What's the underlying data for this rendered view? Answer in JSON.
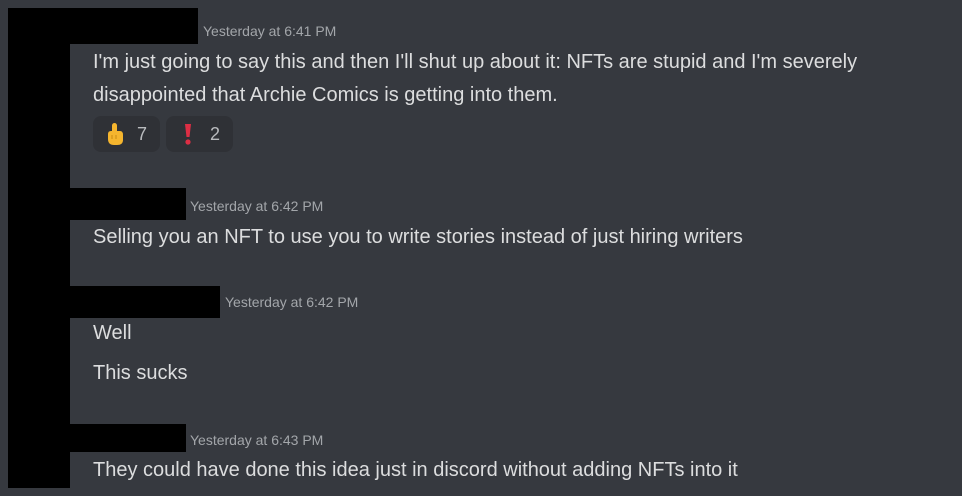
{
  "messages": [
    {
      "timestamp": "Yesterday at 6:41 PM",
      "lines": [
        "I'm just going to say this and then I'll shut up about it: NFTs are stupid and I'm severely",
        "disappointed that Archie Comics is getting into them."
      ],
      "reactions": [
        {
          "emoji": "pointing-up-hand-icon",
          "count": "7"
        },
        {
          "emoji": "exclamation-icon",
          "count": "2"
        }
      ]
    },
    {
      "timestamp": "Yesterday at 6:42 PM",
      "lines": [
        "Selling you an NFT to use you to write stories instead of just hiring writers"
      ]
    },
    {
      "timestamp": "Yesterday at 6:42 PM",
      "lines": [
        "Well",
        "This sucks"
      ]
    },
    {
      "timestamp": "Yesterday at 6:43 PM",
      "lines": [
        "They could have done this idea just in discord without adding NFTs into it"
      ]
    }
  ],
  "colors": {
    "background": "#36393f",
    "message_text": "#dcddde",
    "timestamp_text": "#a3a6aa",
    "reaction_bg": "#2f3136",
    "redaction": "#000000"
  }
}
